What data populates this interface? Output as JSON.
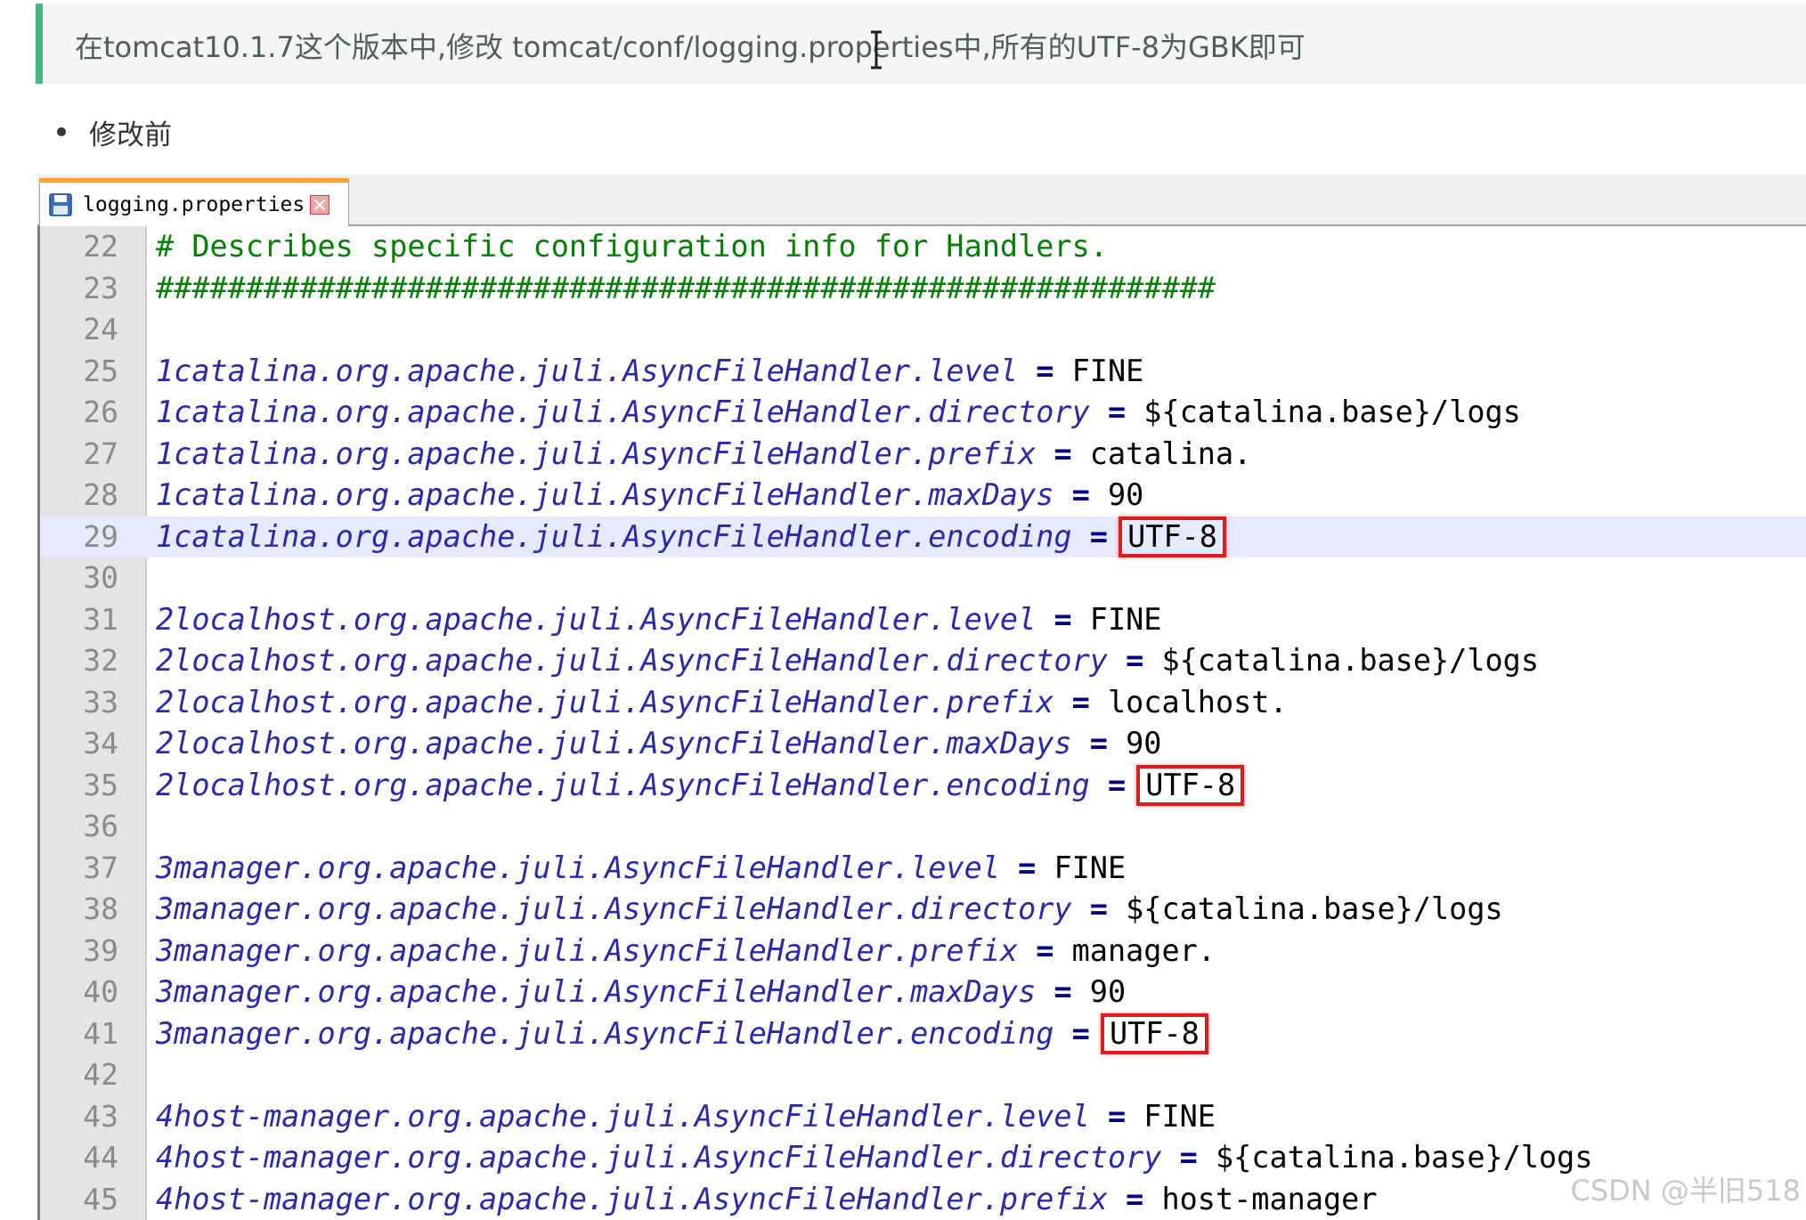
{
  "tip": {
    "text": "在tomcat10.1.7这个版本中,修改 tomcat/conf/logging.properties中,所有的UTF-8为GBK即可"
  },
  "bullet": {
    "text": "修改前"
  },
  "editor": {
    "tab_label": "logging.properties",
    "current_line": 29,
    "lines": [
      {
        "n": "22",
        "comment": "# Describes specific configuration info for Handlers."
      },
      {
        "n": "23",
        "comment": "###########################################################"
      },
      {
        "n": "24"
      },
      {
        "n": "25",
        "key": "1catalina.org.apache.juli.AsyncFileHandler.level",
        "value": "FINE"
      },
      {
        "n": "26",
        "key": "1catalina.org.apache.juli.AsyncFileHandler.directory",
        "value": "${catalina.base}/logs"
      },
      {
        "n": "27",
        "key": "1catalina.org.apache.juli.AsyncFileHandler.prefix",
        "value": "catalina."
      },
      {
        "n": "28",
        "key": "1catalina.org.apache.juli.AsyncFileHandler.maxDays",
        "value": "90"
      },
      {
        "n": "29",
        "key": "1catalina.org.apache.juli.AsyncFileHandler.encoding",
        "value": "UTF-8",
        "highlight": true
      },
      {
        "n": "30"
      },
      {
        "n": "31",
        "key": "2localhost.org.apache.juli.AsyncFileHandler.level",
        "value": "FINE"
      },
      {
        "n": "32",
        "key": "2localhost.org.apache.juli.AsyncFileHandler.directory",
        "value": "${catalina.base}/logs"
      },
      {
        "n": "33",
        "key": "2localhost.org.apache.juli.AsyncFileHandler.prefix",
        "value": "localhost."
      },
      {
        "n": "34",
        "key": "2localhost.org.apache.juli.AsyncFileHandler.maxDays",
        "value": "90"
      },
      {
        "n": "35",
        "key": "2localhost.org.apache.juli.AsyncFileHandler.encoding",
        "value": "UTF-8",
        "highlight": true
      },
      {
        "n": "36"
      },
      {
        "n": "37",
        "key": "3manager.org.apache.juli.AsyncFileHandler.level",
        "value": "FINE"
      },
      {
        "n": "38",
        "key": "3manager.org.apache.juli.AsyncFileHandler.directory",
        "value": "${catalina.base}/logs"
      },
      {
        "n": "39",
        "key": "3manager.org.apache.juli.AsyncFileHandler.prefix",
        "value": "manager."
      },
      {
        "n": "40",
        "key": "3manager.org.apache.juli.AsyncFileHandler.maxDays",
        "value": "90"
      },
      {
        "n": "41",
        "key": "3manager.org.apache.juli.AsyncFileHandler.encoding",
        "value": "UTF-8",
        "highlight": true
      },
      {
        "n": "42"
      },
      {
        "n": "43",
        "key": "4host-manager.org.apache.juli.AsyncFileHandler.level",
        "value": "FINE"
      },
      {
        "n": "44",
        "key": "4host-manager.org.apache.juli.AsyncFileHandler.directory",
        "value": "${catalina.base}/logs"
      },
      {
        "n": "45",
        "key": "4host-manager.org.apache.juli.AsyncFileHandler.prefix",
        "value": "host-manager"
      }
    ]
  },
  "watermark": "CSDN @半旧518",
  "colors": {
    "tip_border": "#42b983",
    "comment": "#008000",
    "key": "#2a2aa8",
    "highlight_box": "#e01b1b",
    "tab_accent": "#f7a33a"
  }
}
